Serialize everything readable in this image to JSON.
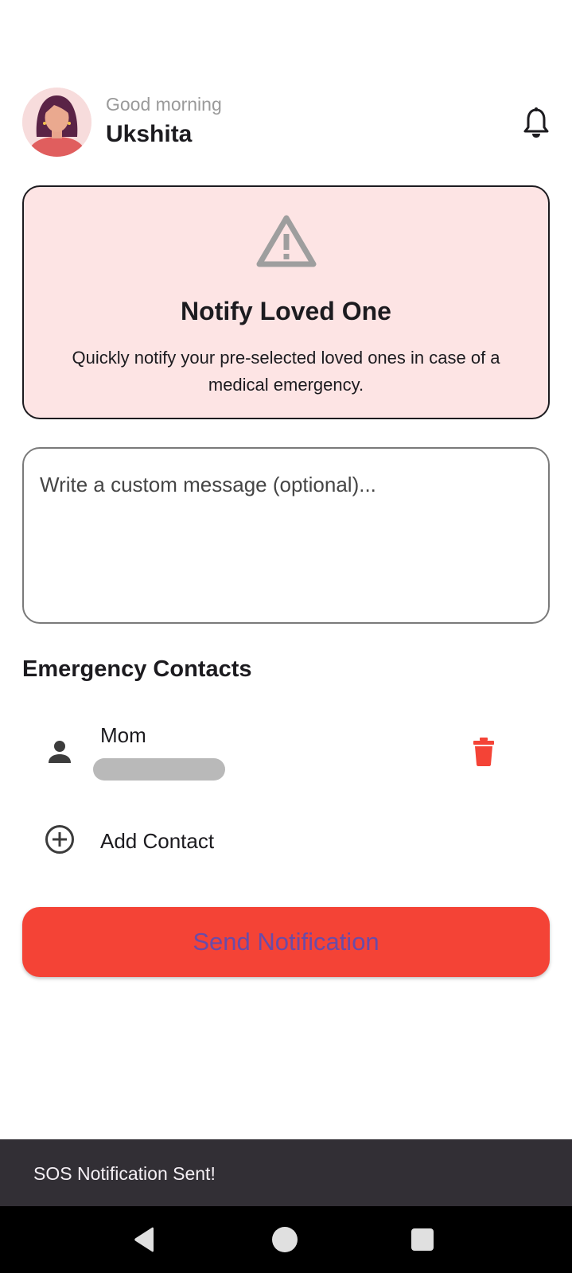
{
  "header": {
    "greeting": "Good morning",
    "username": "Ukshita",
    "notification_icon": "bell-icon",
    "avatar_icon": "woman-avatar"
  },
  "alert_card": {
    "icon": "warning-triangle-icon",
    "title": "Notify Loved One",
    "description": "Quickly notify your pre-selected loved ones in case of a medical emergency.",
    "background": "#fde4e4"
  },
  "message": {
    "placeholder": "Write a custom message (optional)...",
    "value": ""
  },
  "contacts": {
    "title": "Emergency Contacts",
    "items": [
      {
        "name": "Mom",
        "icon": "person-icon",
        "delete_icon": "trash-icon"
      }
    ],
    "add_label": "Add Contact",
    "add_icon": "add-circle-icon"
  },
  "send_button": {
    "label": "Send Notification",
    "background": "#f44336",
    "text_color": "#6a4ba8"
  },
  "snackbar": {
    "text": "SOS Notification Sent!"
  },
  "system_nav": {
    "back_icon": "back-triangle-icon",
    "home_icon": "home-circle-icon",
    "recents_icon": "recents-square-icon"
  }
}
